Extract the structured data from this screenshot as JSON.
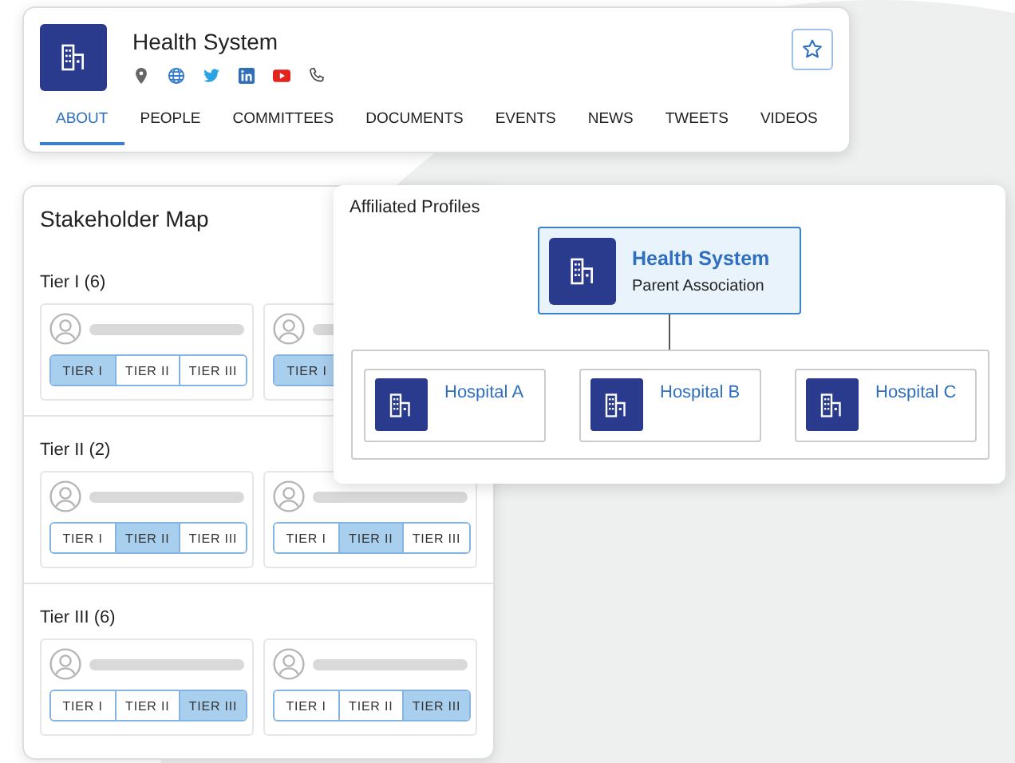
{
  "profile": {
    "title": "Health System",
    "links": [
      {
        "kind": "location"
      },
      {
        "kind": "web"
      },
      {
        "kind": "twitter"
      },
      {
        "kind": "linkedin"
      },
      {
        "kind": "youtube"
      },
      {
        "kind": "phone"
      }
    ],
    "tabs": [
      {
        "label": "ABOUT",
        "selected": true
      },
      {
        "label": "PEOPLE",
        "selected": false
      },
      {
        "label": "COMMITTEES",
        "selected": false
      },
      {
        "label": "DOCUMENTS",
        "selected": false
      },
      {
        "label": "EVENTS",
        "selected": false
      },
      {
        "label": "NEWS",
        "selected": false
      },
      {
        "label": "TWEETS",
        "selected": false
      },
      {
        "label": "VIDEOS",
        "selected": false
      }
    ]
  },
  "stakeholder_map": {
    "title": "Stakeholder Map",
    "sections": [
      {
        "heading": "Tier I (6)",
        "cards": [
          {
            "tiers": [
              {
                "label": "TIER I",
                "selected": true
              },
              {
                "label": "TIER II",
                "selected": false
              },
              {
                "label": "TIER III",
                "selected": false
              }
            ]
          },
          {
            "tiers": [
              {
                "label": "TIER I",
                "selected": true
              }
            ]
          }
        ]
      },
      {
        "heading": "Tier II (2)",
        "cards": [
          {
            "tiers": [
              {
                "label": "TIER I",
                "selected": false
              },
              {
                "label": "TIER II",
                "selected": true
              },
              {
                "label": "TIER III",
                "selected": false
              }
            ]
          },
          {
            "tiers": [
              {
                "label": "TIER I",
                "selected": false
              },
              {
                "label": "TIER II",
                "selected": true
              },
              {
                "label": "TIER III",
                "selected": false
              }
            ]
          }
        ]
      },
      {
        "heading": "Tier III (6)",
        "cards": [
          {
            "tiers": [
              {
                "label": "TIER I",
                "selected": false
              },
              {
                "label": "TIER II",
                "selected": false
              },
              {
                "label": "TIER III",
                "selected": true
              }
            ]
          },
          {
            "tiers": [
              {
                "label": "TIER I",
                "selected": false
              },
              {
                "label": "TIER II",
                "selected": false
              },
              {
                "label": "TIER III",
                "selected": true
              }
            ]
          }
        ]
      }
    ]
  },
  "affiliated_profiles": {
    "title": "Affiliated Profiles",
    "parent": {
      "name": "Health System",
      "role": "Parent Association"
    },
    "children": [
      {
        "name": "Hospital A"
      },
      {
        "name": "Hospital B"
      },
      {
        "name": "Hospital C"
      }
    ]
  }
}
